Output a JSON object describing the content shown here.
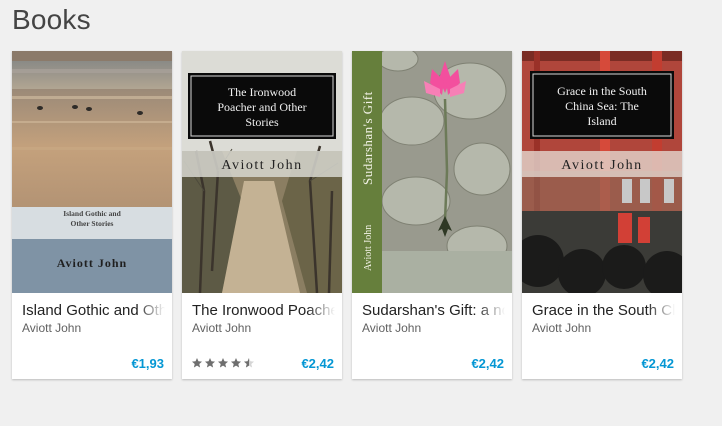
{
  "section": {
    "title": "Books"
  },
  "colors": {
    "price": "#0497d4",
    "star": "#6e6e6e",
    "background": "#f0f0f0",
    "card": "#ffffff"
  },
  "books": [
    {
      "title": "Island Gothic and Other Stories",
      "author": "Aviott John",
      "price": "€1,93",
      "rating": null,
      "cover_title": "Island Gothic and Other Stories",
      "cover_author": "Aviott John"
    },
    {
      "title": "The Ironwood Poacher and Other Stories",
      "author": "Aviott John",
      "price": "€2,42",
      "rating": 4.5,
      "cover_title": "The Ironwood Poacher and Other Stories",
      "cover_author": "Aviott John"
    },
    {
      "title": "Sudarshan's Gift: a novel",
      "author": "Aviott John",
      "price": "€2,42",
      "rating": null,
      "cover_title": "Sudarshan's Gift",
      "cover_author": "Aviott John"
    },
    {
      "title": "Grace in the South China Sea: The Island",
      "author": "Aviott John",
      "price": "€2,42",
      "rating": null,
      "cover_title": "Grace in the South China Sea: The Island",
      "cover_author": "Aviott John"
    }
  ]
}
